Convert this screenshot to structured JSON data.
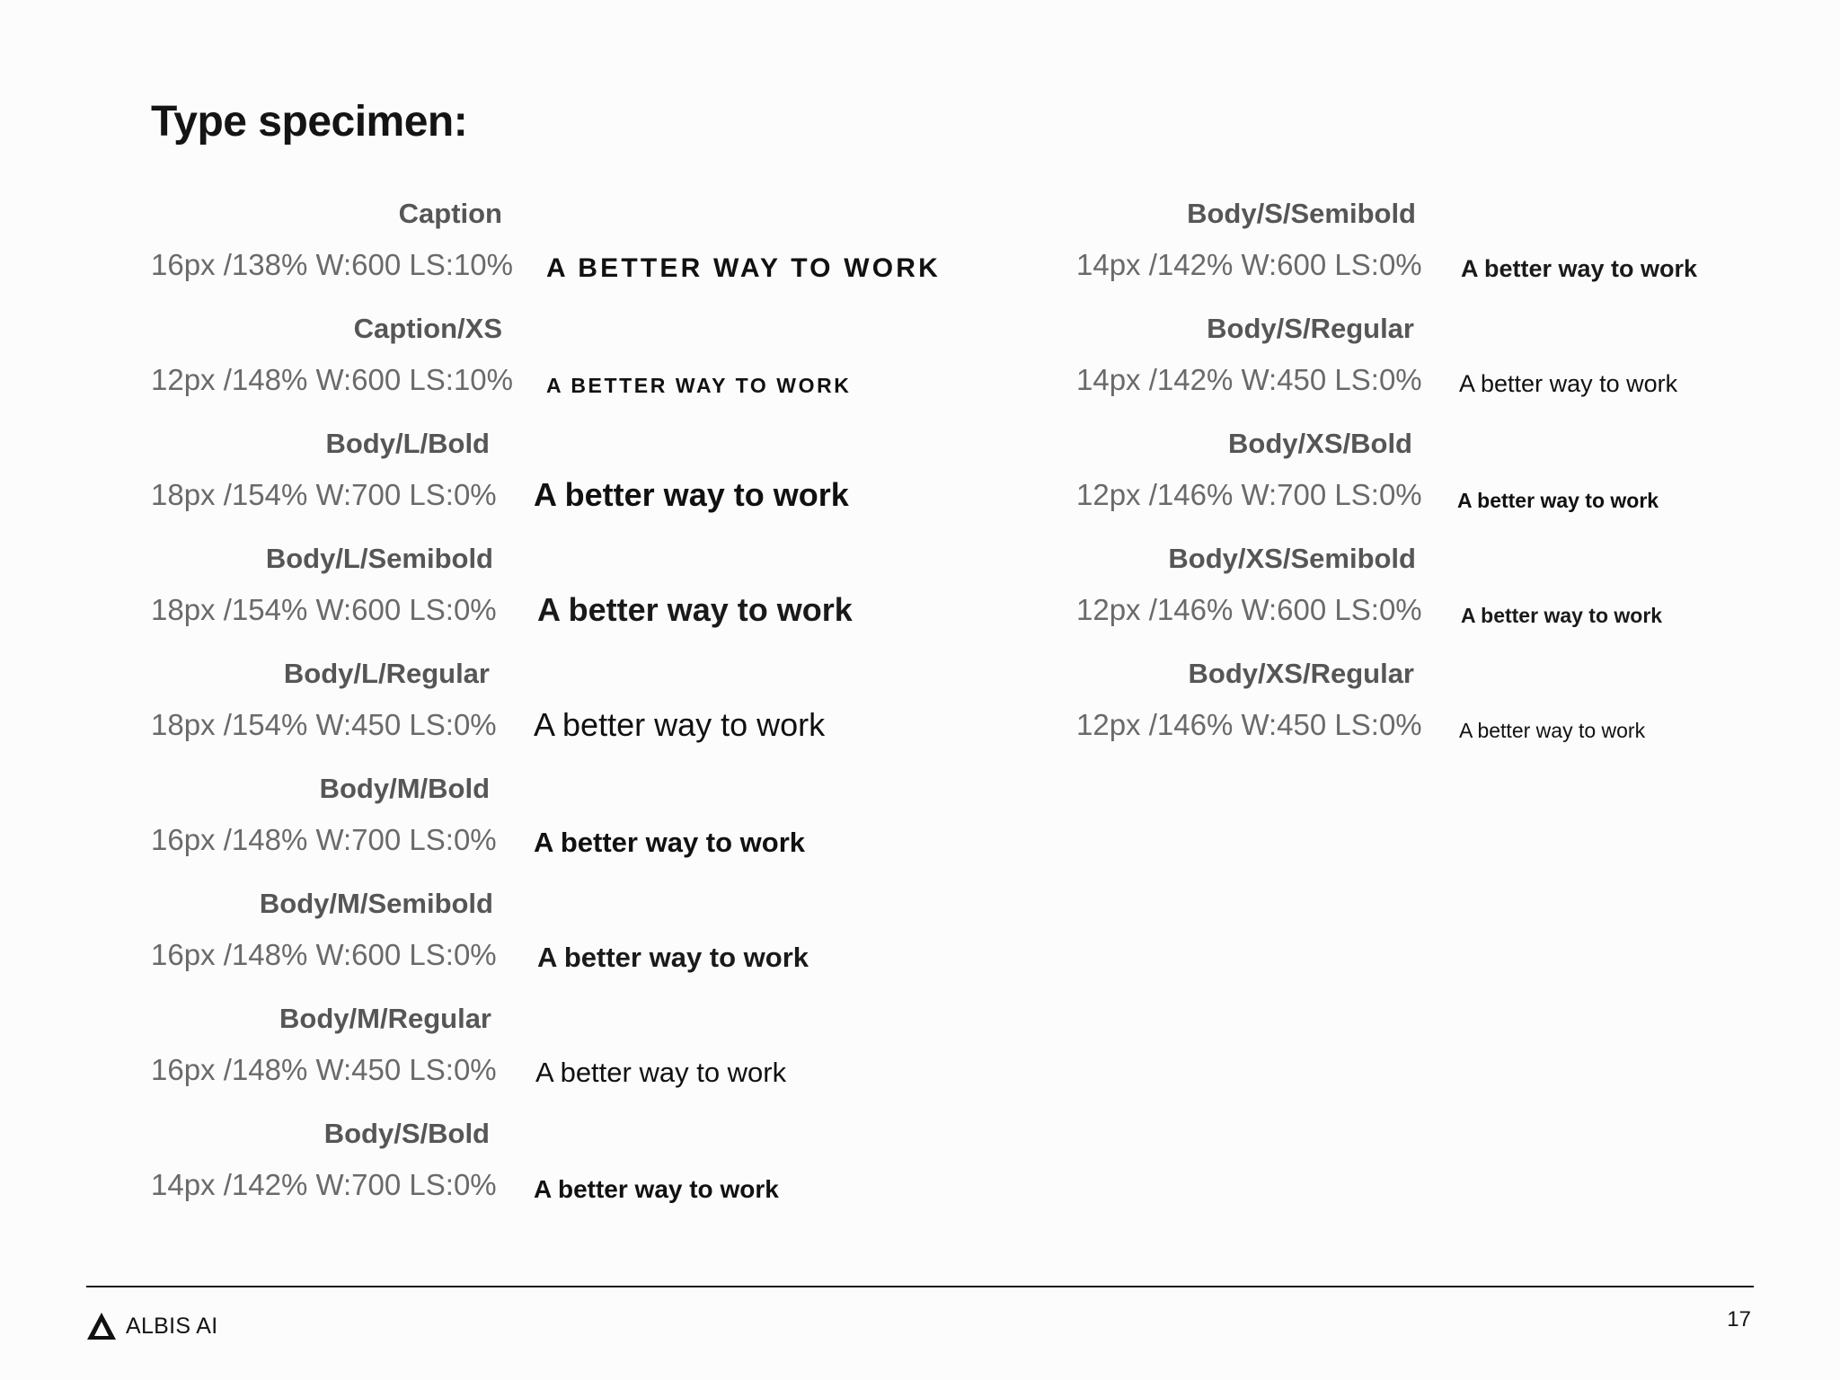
{
  "page": {
    "title": "Type specimen:",
    "sample_text": "A better way to work",
    "sample_text_caps": "A BETTER WAY TO WORK",
    "footer": {
      "brand": "ALBIS AI",
      "logo_icon": "albis-delta-logo-icon",
      "page_number": "17"
    }
  },
  "left_column": [
    {
      "name": "Caption",
      "spec": "16px /138% W:600 LS:10%",
      "sample": "A BETTER WAY TO WORK"
    },
    {
      "name": "Caption/XS",
      "spec": "12px /148% W:600 LS:10%",
      "sample": "A BETTER WAY TO WORK"
    },
    {
      "name": "Body/L/Bold",
      "spec": "18px /154% W:700 LS:0%",
      "sample": "A better way to work"
    },
    {
      "name": "Body/L/Semibold",
      "spec": "18px /154% W:600 LS:0%",
      "sample": "A better way to work"
    },
    {
      "name": "Body/L/Regular",
      "spec": "18px /154% W:450 LS:0%",
      "sample": "A better way to work"
    },
    {
      "name": "Body/M/Bold",
      "spec": "16px /148% W:700 LS:0%",
      "sample": "A better way to work"
    },
    {
      "name": "Body/M/Semibold",
      "spec": "16px /148% W:600 LS:0%",
      "sample": "A better way to work"
    },
    {
      "name": "Body/M/Regular",
      "spec": "16px /148% W:450 LS:0%",
      "sample": "A better way to work"
    },
    {
      "name": "Body/S/Bold",
      "spec": "14px /142% W:700 LS:0%",
      "sample": "A better way to work"
    }
  ],
  "right_column": [
    {
      "name": "Body/S/Semibold",
      "spec": "14px /142% W:600 LS:0%",
      "sample": "A better way to work"
    },
    {
      "name": "Body/S/Regular",
      "spec": "14px /142% W:450 LS:0%",
      "sample": "A better way to work"
    },
    {
      "name": "Body/XS/Bold",
      "spec": "12px /146% W:700 LS:0%",
      "sample": "A better way to work"
    },
    {
      "name": "Body/XS/Semibold",
      "spec": "12px /146% W:600 LS:0%",
      "sample": "A better way to work"
    },
    {
      "name": "Body/XS/Regular",
      "spec": "12px /146% W:450 LS:0%",
      "sample": "A better way to work"
    }
  ],
  "colors": {
    "background": "#fcfcfc",
    "title": "#141414",
    "style_name": "#565656",
    "spec": "#6a6a6a",
    "sample": "#111111",
    "rule": "#1a1a1a"
  }
}
